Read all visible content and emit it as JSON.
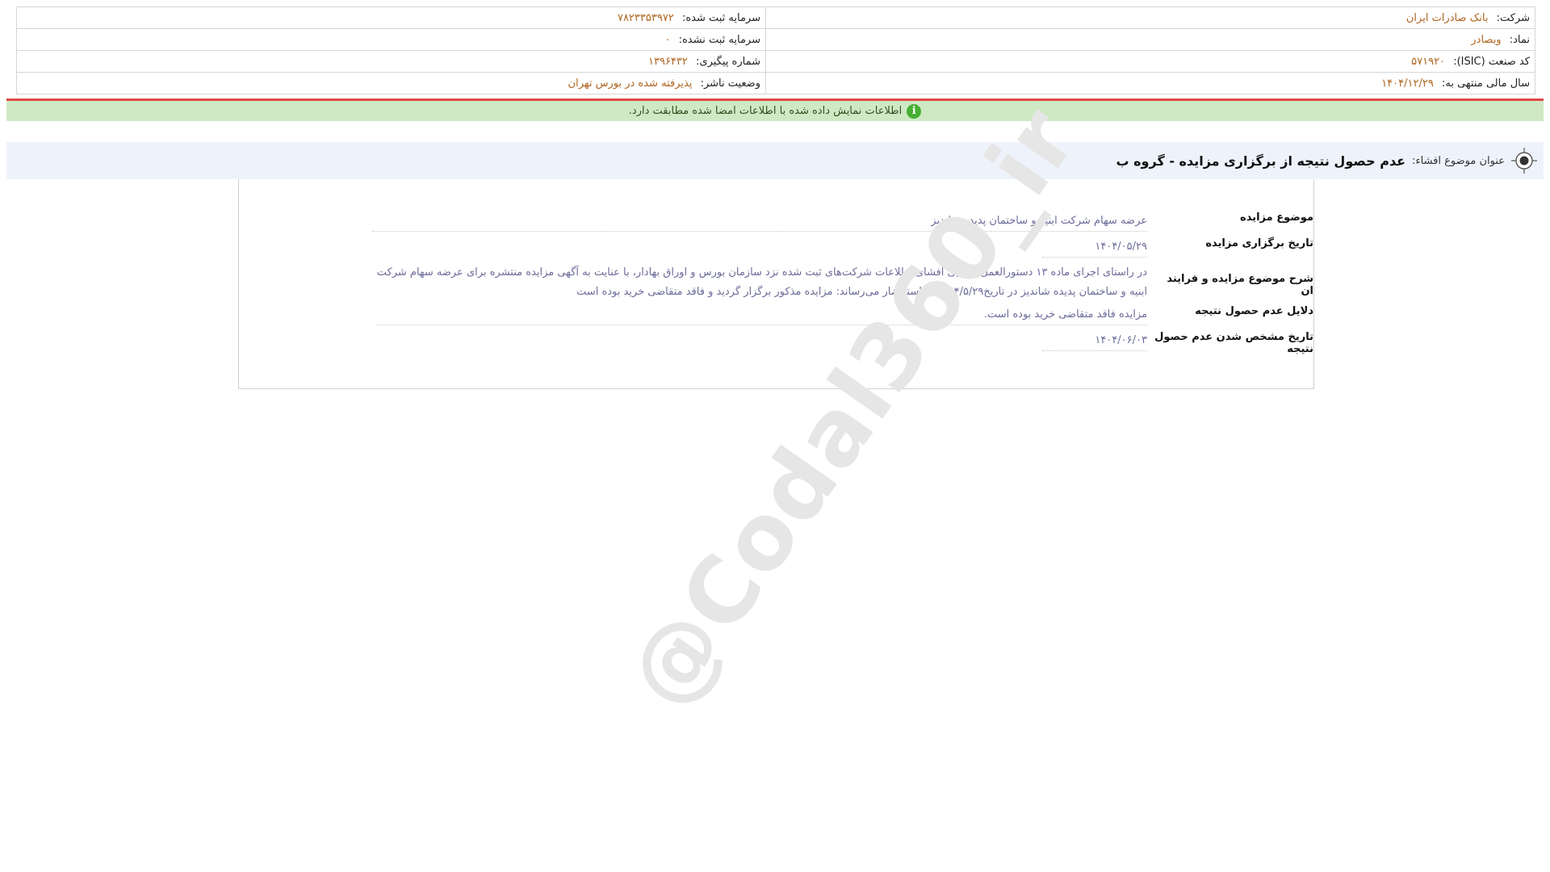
{
  "header": {
    "company_label": "شرکت:",
    "company_value": "بانک صادرات ایران",
    "symbol_label": "نماد:",
    "symbol_value": "وبصادر",
    "isic_label": "کد صنعت (ISIC):",
    "isic_value": "۵۷۱۹۲۰",
    "fiscal_label": "سال مالی منتهی به:",
    "fiscal_value": "۱۴۰۴/۱۲/۲۹",
    "capital_reg_label": "سرمایه ثبت شده:",
    "capital_reg_value": "۷۸۲۳۳۵۳۹۷۲",
    "capital_unreg_label": "سرمایه ثبت نشده:",
    "capital_unreg_value": "۰",
    "tracking_label": "شماره پیگیری:",
    "tracking_value": "۱۳۹۶۴۳۲",
    "publisher_status_label": "وضعیت ناشر:",
    "publisher_status_value": "پذیرفته شده در بورس تهران"
  },
  "verify": {
    "icon": "info-icon",
    "text": "اطلاعات نمایش داده شده با اطلاعات امضا شده مطابقت دارد."
  },
  "subject": {
    "label": "عنوان موضوع افشاء:",
    "title": "عدم حصول نتیجه از برگزاری مزایده - گروه ب"
  },
  "details": [
    {
      "label": "موضوع مزایده",
      "value": "عرضه سهام شرکت ابنیه و ساختمان پدیده شاندیز"
    },
    {
      "label": "تاریخ برگزاری مزایده",
      "value": "۱۴۰۴/۰۵/۲۹"
    },
    {
      "label": "شرح موضوع مزایده و فرایند ان",
      "value": "در راستای اجرای ماده ۱۳ دستورالعمل اجرایی افشای اطلاعات شرکت‌های ثبت شده نزد سازمان بورس و اوراق بهادار، با عنایت به آگهی مزایده منتشره برای عرضه سهام شرکت ابنیه و ساختمان پدیده شاندیز در تاریخ۱۴۰۴/۵/۲۹ به استحضار می‌رساند: مزایده مذکور برگزار گردید و فاقد متقاضی خرید بوده است"
    },
    {
      "label": "دلایل عدم حصول نتیجه",
      "value": "مزایده فاقد متقاضی خرید بوده است."
    },
    {
      "label": "تاریخ مشخص شدن عدم حصول نتیجه",
      "value": "۱۴۰۴/۰۶/۰۳"
    }
  ],
  "watermark": "@Codal360_ir",
  "colors": {
    "value_orange": "#b0641e",
    "value_blue": "#6c6c9a",
    "verify_green": "#cfe9c4",
    "verify_red_line": "#e04848"
  }
}
